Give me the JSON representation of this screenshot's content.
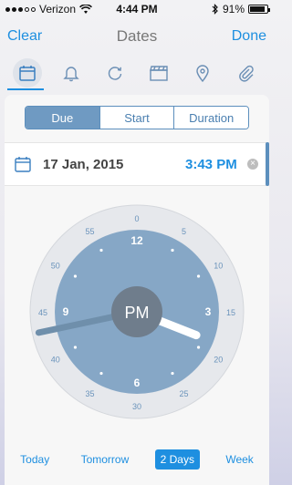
{
  "status_bar": {
    "carrier": "Verizon",
    "time": "4:44 PM",
    "battery": "91%",
    "battery_level": 0.91
  },
  "nav": {
    "left_button": "Clear",
    "title": "Dates",
    "right_button": "Done"
  },
  "toolbar": {
    "icons": [
      "calendar-icon",
      "bell-icon",
      "repeat-icon",
      "clapperboard-icon",
      "location-pin-icon",
      "paperclip-icon"
    ],
    "active": "calendar-icon"
  },
  "segments": {
    "items": [
      "Due",
      "Start",
      "Duration"
    ],
    "selected": "Due"
  },
  "date_row": {
    "date": "17 Jan, 2015",
    "time": "3:43 PM",
    "clear_icon": "close-circle-icon"
  },
  "clock": {
    "ampm": "PM",
    "hour": 3,
    "minute": 43,
    "hour_labels": [
      "12",
      "3",
      "6",
      "9"
    ],
    "minute_labels": [
      "0",
      "5",
      "10",
      "15",
      "20",
      "25",
      "30",
      "35",
      "40",
      "45",
      "50",
      "55"
    ],
    "colors": {
      "outer": "#e6e8ec",
      "inner": "#86a7c6",
      "center": "#6f7d8c",
      "accent": "#1e8fe0"
    }
  },
  "quick_options": {
    "items": [
      "Today",
      "Tomorrow",
      "2 Days",
      "Week"
    ],
    "selected": "2 Days"
  }
}
